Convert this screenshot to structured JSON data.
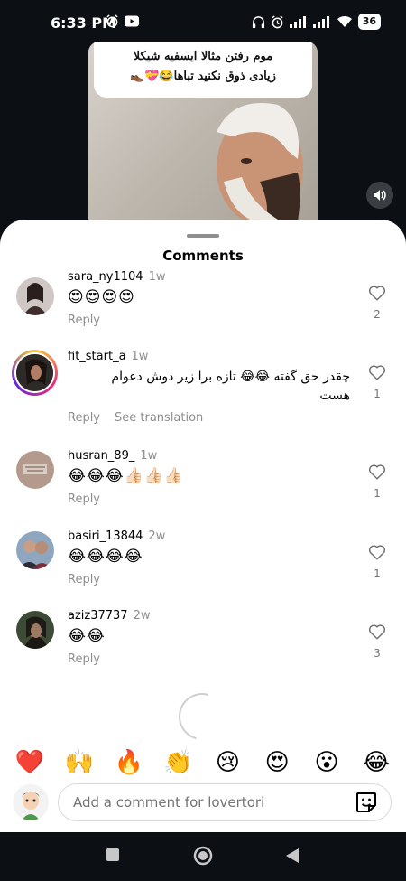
{
  "status_bar": {
    "time": "6:33 PM",
    "battery": "36"
  },
  "video": {
    "caption_line1": "موم رفتن مثالا ایسفیه شیکلا",
    "caption_line2": "زیادی ذوق نکنید تباها😂💝👞"
  },
  "sheet": {
    "title": "Comments"
  },
  "comments": [
    {
      "username": "sara_ny1104",
      "time": "1w",
      "text": "😍😍😍😍",
      "reply": "Reply",
      "likes": "2"
    },
    {
      "username": "fit_start_a",
      "time": "1w",
      "text": "چقدر حق گفته 😂😂 تازه برا زیر دوش  دعوام هست",
      "reply": "Reply",
      "translate": "See translation",
      "likes": "1"
    },
    {
      "username": "husran_89_",
      "time": "1w",
      "text": "😂😂😂👍🏻👍🏻👍🏻",
      "reply": "Reply",
      "likes": "1"
    },
    {
      "username": "basiri_13844",
      "time": "2w",
      "text": "😂😂😂😂",
      "reply": "Reply",
      "likes": "1"
    },
    {
      "username": "aziz37737",
      "time": "2w",
      "text": "😂😂",
      "reply": "Reply",
      "likes": "3"
    }
  ],
  "reactions": [
    "❤️",
    "🙌",
    "🔥",
    "👏",
    "😢",
    "😍",
    "😮",
    "😂"
  ],
  "composer": {
    "placeholder": "Add a comment for lovertori"
  },
  "colors": {
    "sheet_bg": "#ffffff",
    "screen_bg": "#0c0f14",
    "muted_text": "#8e8e8e"
  }
}
